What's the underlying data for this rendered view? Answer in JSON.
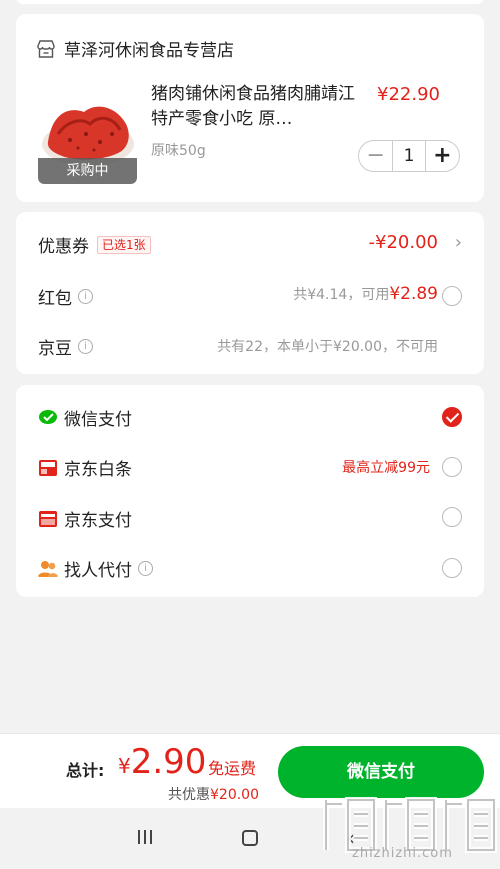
{
  "store": {
    "name": "草泽河休闲食品专营店",
    "icon": "store-icon"
  },
  "product": {
    "title": "猪肉铺休闲食品猪肉脯靖江特产零食小吃 原…",
    "spec": "原味50g",
    "price": "¥22.90",
    "tag": "采购中",
    "quantity": "1",
    "minus": "−",
    "plus": "+"
  },
  "discounts": {
    "coupon_label": "优惠券",
    "coupon_tag": "已选1张",
    "coupon_value": "-¥20.00",
    "hongbao_label": "红包",
    "hongbao_total": "共¥4.14，可用",
    "hongbao_available": "¥2.89",
    "jingdou_label": "京豆",
    "jingdou_text": "共有22，本单小于¥20.00，不可用"
  },
  "payment": {
    "methods": [
      {
        "label": "微信支付",
        "icon": "wechat-pay-icon",
        "selected": true
      },
      {
        "label": "京东白条",
        "icon": "jd-baitiao-icon",
        "promo": "最高立减99元",
        "selected": false
      },
      {
        "label": "京东支付",
        "icon": "jd-pay-icon",
        "selected": false
      },
      {
        "label": "找人代付",
        "icon": "people-icon",
        "selected": false
      }
    ]
  },
  "summary": {
    "total_label": "总计:",
    "currency": "¥",
    "total": "2.90",
    "free_shipping": "免运费",
    "discount_prefix": "共优惠",
    "discount_amount": "¥20.00",
    "pay_button": "微信支付"
  },
  "watermark": {
    "text": "zhizhizhi.com"
  },
  "colors": {
    "accent_red": "#e2231a",
    "pay_green": "#00b32c"
  }
}
